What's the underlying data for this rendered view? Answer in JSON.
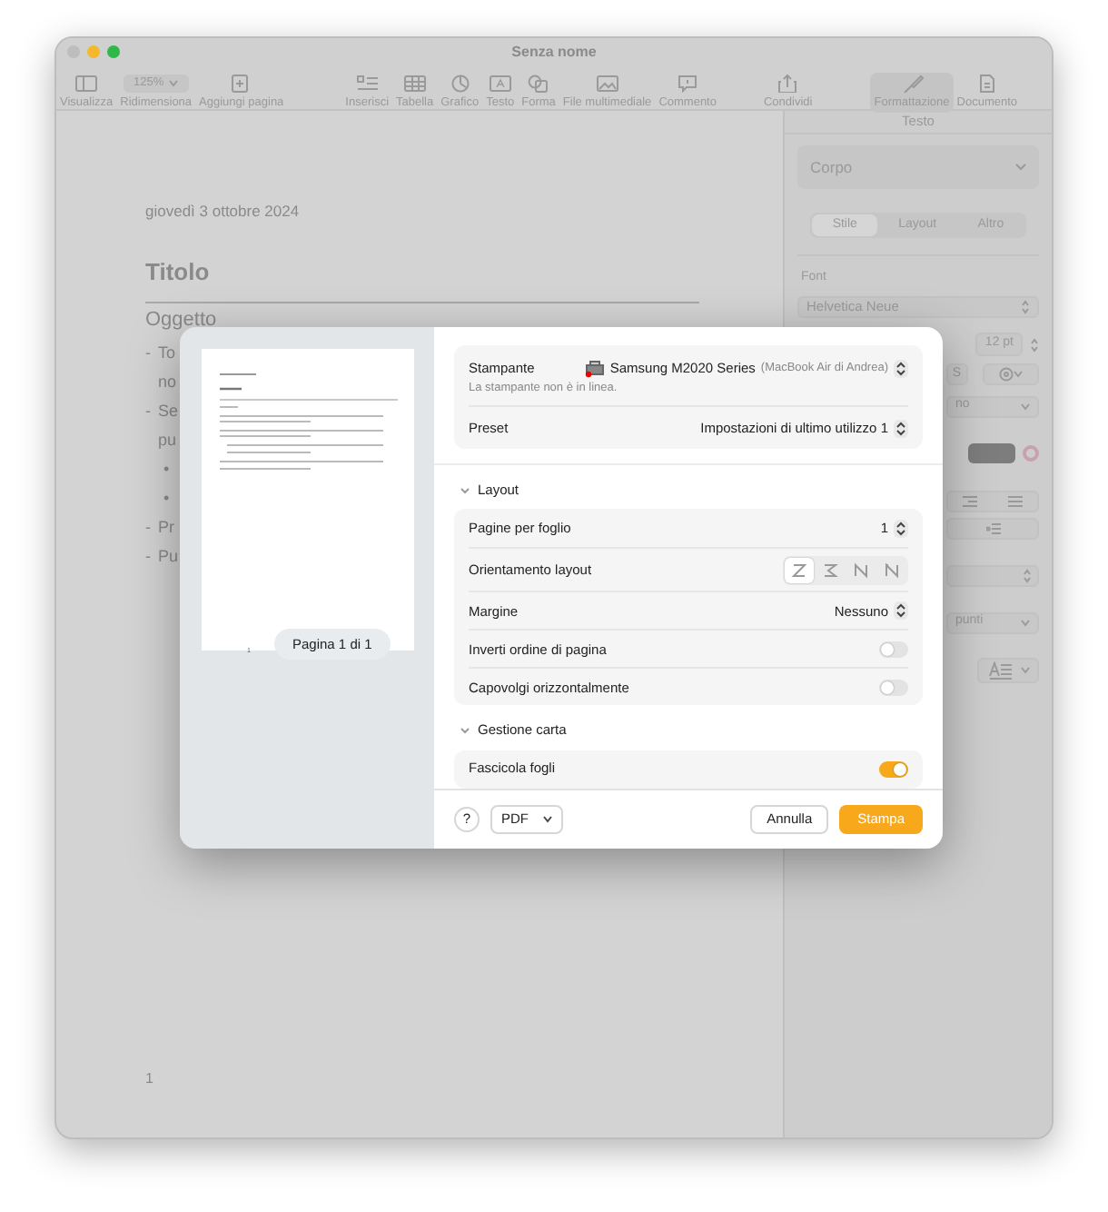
{
  "window": {
    "title": "Senza nome"
  },
  "toolbar": [
    {
      "kind": "button",
      "label": "Visualizza",
      "selected": false
    },
    {
      "kind": "zoom",
      "label": "Ridimensiona",
      "value": "125%",
      "selected": false
    },
    {
      "kind": "button",
      "label": "Aggiungi pagina",
      "selected": false
    },
    {
      "kind": "button",
      "label": "Inserisci",
      "selected": false
    },
    {
      "kind": "button",
      "label": "Tabella",
      "selected": false
    },
    {
      "kind": "button",
      "label": "Grafico",
      "selected": false
    },
    {
      "kind": "button",
      "label": "Testo",
      "selected": false
    },
    {
      "kind": "button",
      "label": "Forma",
      "selected": false
    },
    {
      "kind": "button",
      "label": "File multimediale",
      "selected": false
    },
    {
      "kind": "button",
      "label": "Commento",
      "selected": false
    },
    {
      "kind": "button",
      "label": "Condividi",
      "selected": false
    },
    {
      "kind": "button",
      "label": "Formattazione",
      "selected": true
    },
    {
      "kind": "button",
      "label": "Documento",
      "selected": false
    }
  ],
  "document": {
    "date": "giovedì 3 ottobre 2024",
    "title": "Titolo",
    "subtitle": "Oggetto",
    "lines": [
      {
        "marker": "-",
        "text": "To"
      },
      {
        "text": "no"
      },
      {
        "marker": "-",
        "text": "Se"
      },
      {
        "text": "pu"
      },
      {
        "marker": "•"
      },
      {
        "marker": "•"
      },
      {
        "marker": "-",
        "text": "Pr"
      },
      {
        "marker": "-",
        "text": "Pu"
      }
    ],
    "page_number": "1"
  },
  "sidebar": {
    "header": "Testo",
    "paragraph_style": "Corpo",
    "tabs": [
      {
        "label": "Stile",
        "selected": true
      },
      {
        "label": "Layout",
        "selected": false
      },
      {
        "label": "Altro",
        "selected": false
      }
    ],
    "font_label": "Font",
    "font": "Helvetica Neue",
    "size": "12 pt",
    "style_fragment": "S",
    "typeface_fragment": "no",
    "spacing_fragment": "punti"
  },
  "print_dialog": {
    "preview": {
      "page_label": "Pagina 1 di 1",
      "page_number": "1"
    },
    "printer": {
      "label": "Stampante",
      "name": "Samsung M2020 Series",
      "host": "(MacBook Air di Andrea)",
      "status": "La stampante non è in linea."
    },
    "preset": {
      "label": "Preset",
      "value": "Impostazioni di ultimo utilizzo 1"
    },
    "sections": [
      {
        "title": "Layout",
        "expanded": true,
        "rows": [
          {
            "kind": "stepper",
            "label": "Pagine per foglio",
            "value": "1"
          },
          {
            "kind": "orientation",
            "label": "Orientamento layout",
            "options": [
              {
                "selected": true
              },
              {
                "selected": false
              },
              {
                "selected": false
              },
              {
                "selected": false
              }
            ]
          },
          {
            "kind": "select",
            "label": "Margine",
            "value": "Nessuno"
          },
          {
            "kind": "toggle",
            "label": "Inverti ordine di pagina",
            "on": false
          },
          {
            "kind": "toggle",
            "label": "Capovolgi orizzontalmente",
            "on": false
          }
        ]
      },
      {
        "title": "Gestione carta",
        "expanded": true,
        "rows": [
          {
            "kind": "toggle",
            "label": "Fascicola fogli",
            "on": true
          }
        ]
      }
    ],
    "footer": {
      "help": "?",
      "format": "PDF",
      "cancel": "Annulla",
      "print": "Stampa"
    }
  }
}
